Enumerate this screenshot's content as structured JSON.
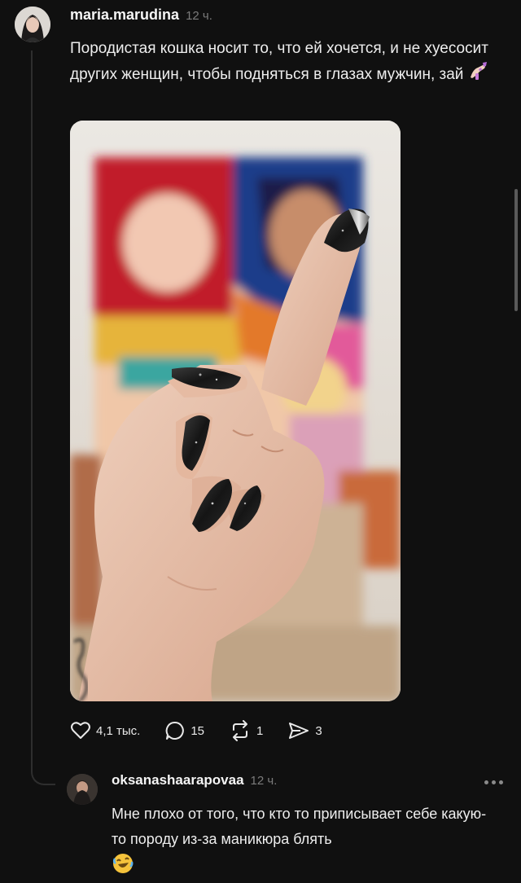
{
  "post": {
    "username": "maria.marudina",
    "time": "12 ч.",
    "text": "Породистая кошка носит то, что ей хочется, и не хуесосит других женщин, чтобы подняться в глазах мужчин, зай",
    "emoji": "nail-polish-emoji",
    "photo_alt": "Hand with long black glitter nails showing middle finger in front of a Disney princess painting",
    "actions": {
      "likes": "4,1 тыс.",
      "comments": "15",
      "reposts": "1",
      "shares": "3"
    }
  },
  "reply": {
    "username": "oksanashaarapovaa",
    "time": "12 ч.",
    "text": "Мне плохо от того, что кто то приписывает себе какую- то породу из-за маникюра блять",
    "emoji": "rofl-emoji"
  },
  "colors": {
    "background": "#101010",
    "text": "#eeeeee",
    "muted": "#7b7b7b",
    "thread_line": "#2e2e2e",
    "nail": "#1a1a1a"
  }
}
